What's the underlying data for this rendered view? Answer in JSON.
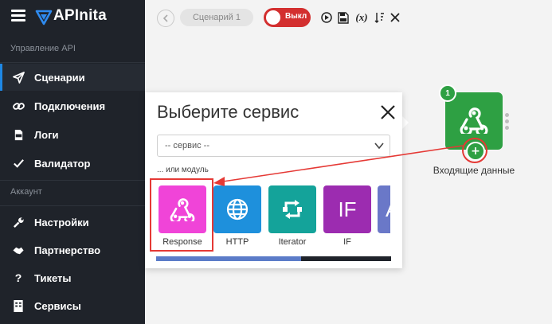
{
  "brand": {
    "name": "APInita"
  },
  "sidebar": {
    "section_api": "Управление API",
    "section_account": "Аккаунт",
    "items": [
      {
        "label": "Сценарии",
        "icon": "send-icon",
        "active": true
      },
      {
        "label": "Подключения",
        "icon": "link-icon"
      },
      {
        "label": "Логи",
        "icon": "log-icon"
      },
      {
        "label": "Валидатор",
        "icon": "check-icon"
      },
      {
        "label": "Настройки",
        "icon": "wrench-icon"
      },
      {
        "label": "Партнерство",
        "icon": "handshake-icon"
      },
      {
        "label": "Тикеты",
        "icon": "question-icon"
      },
      {
        "label": "Сервисы",
        "icon": "services-icon"
      }
    ]
  },
  "toolbar": {
    "scenario_name": "Сценарий 1",
    "toggle_label": "Выкл",
    "variables_label": "(x)",
    "icons": [
      "play-icon",
      "save-icon",
      "variables-icon",
      "sort-icon",
      "close-icon"
    ]
  },
  "node": {
    "badge": "1",
    "caption": "Входящие данные",
    "color": "#2ea043"
  },
  "modal": {
    "title": "Выберите сервис",
    "select_value": "-- сервис --",
    "or_module": "... или модуль",
    "tiles": [
      {
        "label": "Response",
        "color": "#f044d8",
        "icon": "webhook-icon"
      },
      {
        "label": "HTTP",
        "color": "#1e90dc",
        "icon": "globe-icon"
      },
      {
        "label": "Iterator",
        "color": "#14a39a",
        "icon": "iterator-icon"
      },
      {
        "label": "IF",
        "color": "#9c2cb0",
        "text": "IF"
      },
      {
        "label": "",
        "color": "#6a78c8",
        "text": "A"
      }
    ]
  },
  "colors": {
    "sidebar_bg": "#1f232a",
    "accent": "#1e88e5",
    "annotation_red": "#e53935"
  }
}
